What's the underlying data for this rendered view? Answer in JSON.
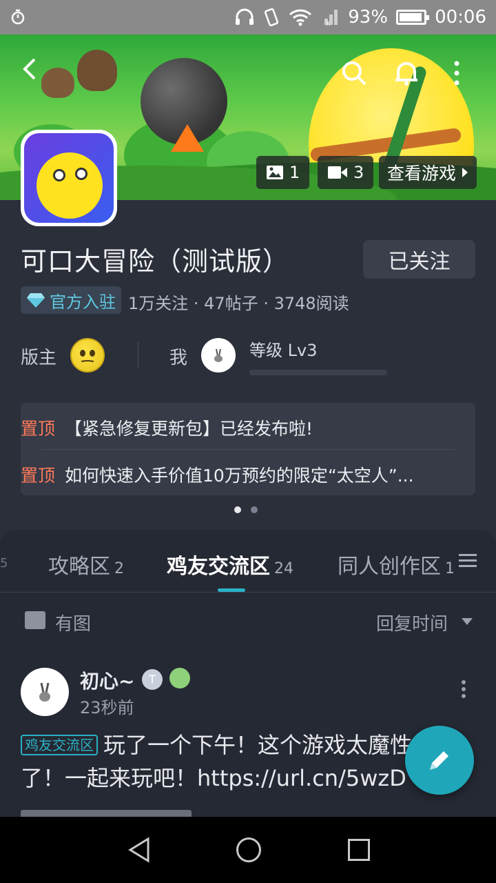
{
  "status_bar": {
    "battery": "93%",
    "time": "00:06",
    "battery_level": 0.93
  },
  "header": {
    "photo_count": "1",
    "video_count": "3",
    "view_game": "查看游戏"
  },
  "game": {
    "title": "可口大冒险（测试版）",
    "follow_label": "已关注",
    "official_badge": "官方入驻",
    "stats": "1万关注 · 47帖子 · 3748阅读"
  },
  "moderator": {
    "label": "版主",
    "me_label": "我",
    "level": "等级 Lv3"
  },
  "pinned": [
    {
      "tag": "置顶",
      "text": "【紧急修复更新包】已经发布啦!"
    },
    {
      "tag": "置顶",
      "text": "如何快速入手价值10万预约的限定“太空人”..."
    }
  ],
  "tabs": {
    "edge": "5",
    "items": [
      {
        "label": "攻略区",
        "count": "2"
      },
      {
        "label": "鸡友交流区",
        "count": "24"
      },
      {
        "label": "同人创作区",
        "count": "1"
      }
    ]
  },
  "filter": {
    "image_filter": "有图",
    "sort": "回复时间"
  },
  "post": {
    "author": "初心~",
    "badge": "T",
    "time": "23秒前",
    "tag": "鸡友交流区",
    "text": "玩了一个下午！这个游戏太魔性了！一起来玩吧！https://url.cn/5wzD"
  },
  "colors": {
    "accent": "#2bb1c6",
    "pinned_tag": "#ff7a5a",
    "background": "#2b2f3a"
  }
}
